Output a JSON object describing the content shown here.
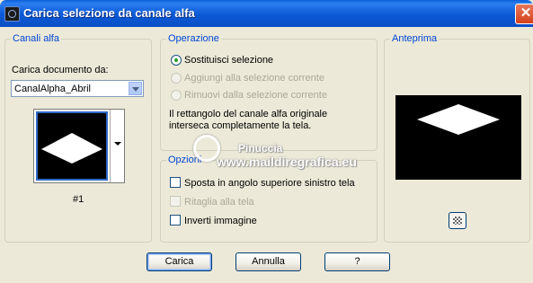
{
  "window": {
    "title": "Carica selezione da canale alfa",
    "close_glyph": "✕"
  },
  "channels": {
    "group_label": "Canali alfa",
    "load_label": "Carica documento da:",
    "document_value": "CanalAlpha_Abril",
    "thumbnail_caption": "#1"
  },
  "operation": {
    "group_label": "Operazione",
    "options": [
      {
        "label": "Sostituisci selezione",
        "checked": true,
        "enabled": true
      },
      {
        "label": "Aggiungi alla selezione corrente",
        "checked": false,
        "enabled": false
      },
      {
        "label": "Rimuovi dalla selezione corrente",
        "checked": false,
        "enabled": false
      }
    ],
    "info_line1": "Il rettangolo del canale alfa originale",
    "info_line2": "interseca completamente la tela."
  },
  "options": {
    "group_label": "Opzioni",
    "items": [
      {
        "label": "Sposta in angolo superiore sinistro tela",
        "checked": false,
        "enabled": true
      },
      {
        "label": "Ritaglia alla tela",
        "checked": false,
        "enabled": false
      },
      {
        "label": "Inverti immagine",
        "checked": false,
        "enabled": true
      }
    ]
  },
  "preview": {
    "group_label": "Anteprima",
    "toggle_icon": "checkerboard-icon"
  },
  "watermark": {
    "line1": "Pinuccia",
    "line2": "www.maildiregrafica.eu"
  },
  "buttons": {
    "ok": "Carica",
    "cancel": "Annulla",
    "help": "?"
  },
  "colors": {
    "titlebar": "#0a5fd8",
    "group_label": "#0046d5",
    "face": "#ece9d8"
  }
}
